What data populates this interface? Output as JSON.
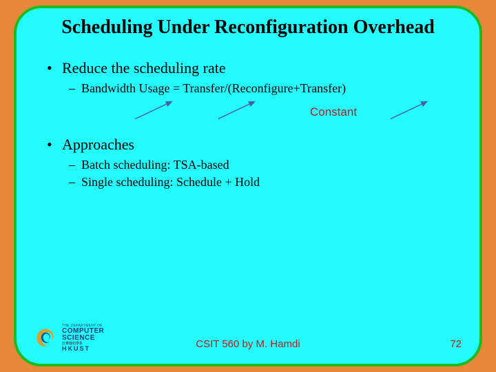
{
  "title": "Scheduling Under Reconfiguration Overhead",
  "bullets": [
    {
      "level": 1,
      "text": "Reduce the scheduling rate",
      "children": [
        {
          "level": 2,
          "text": "Bandwidth Usage = Transfer/(Reconfigure+Transfer)"
        }
      ]
    },
    {
      "level": 1,
      "text": "Approaches",
      "children": [
        {
          "level": 2,
          "text": "Batch scheduling: TSA-based"
        },
        {
          "level": 2,
          "text": "Single scheduling: Schedule + Hold"
        }
      ]
    }
  ],
  "annotation": "Constant",
  "footer": {
    "text": "CSIT 560 by M. Hamdi",
    "page": "72"
  },
  "logo": {
    "line0": "THE DEPARTMENT OF",
    "line1": "COMPUTER SCIENCE",
    "line2": "計算機科學系",
    "line3": "HKUST"
  },
  "colors": {
    "background": "#e8873a",
    "slide": "#23fbfd",
    "border": "#1fba1f",
    "accent": "#c01818",
    "arrow": "#4a5fa8"
  }
}
